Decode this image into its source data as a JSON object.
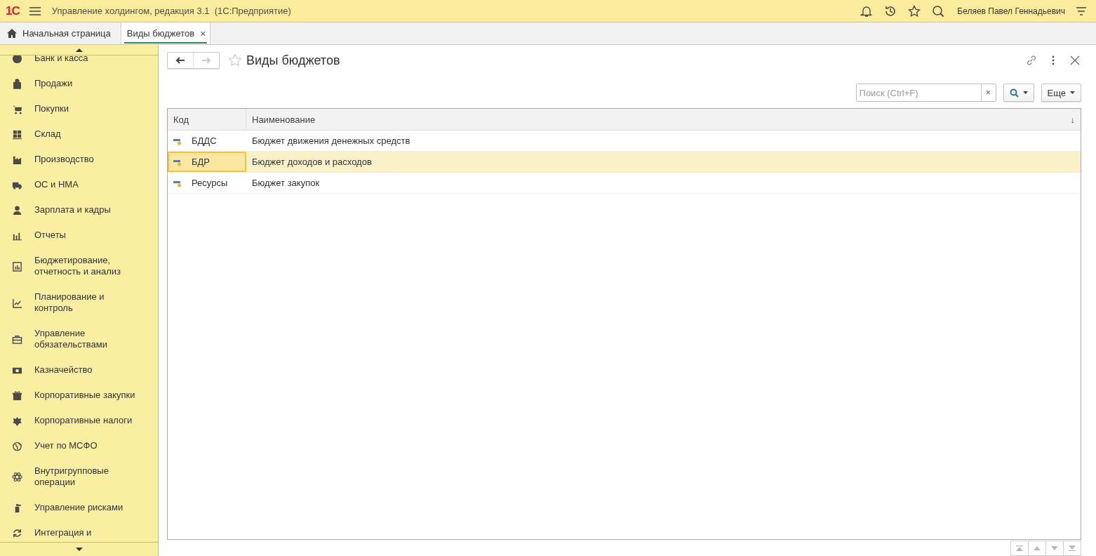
{
  "app": {
    "logo": "1С",
    "title": "Управление холдингом, редакция 3.1  (1С:Предприятие)",
    "user": "Беляев Павел Геннадьевич"
  },
  "tabs": [
    {
      "label": "Начальная страница",
      "selected": false,
      "kind": "home"
    },
    {
      "label": "Виды бюджетов",
      "selected": true,
      "kind": "page",
      "close": "×"
    }
  ],
  "sidebar": {
    "items": [
      {
        "label": "Банк и касса",
        "selected": false
      },
      {
        "label": "Продажи",
        "selected": false
      },
      {
        "label": "Покупки",
        "selected": false
      },
      {
        "label": "Склад",
        "selected": false
      },
      {
        "label": "Производство",
        "selected": false
      },
      {
        "label": "ОС и НМА",
        "selected": false
      },
      {
        "label": "Зарплата и кадры",
        "selected": false
      },
      {
        "label": "Отчеты",
        "selected": false
      },
      {
        "label": "Бюджетирование, отчетность и анализ",
        "selected": false
      },
      {
        "label": "Планирование и контроль",
        "selected": false
      },
      {
        "label": "Управление обязательствами",
        "selected": false
      },
      {
        "label": "Казначейство",
        "selected": false
      },
      {
        "label": "Корпоративные закупки",
        "selected": false
      },
      {
        "label": "Корпоративные налоги",
        "selected": false
      },
      {
        "label": "Учет по МСФО",
        "selected": false
      },
      {
        "label": "Внутригрупповые операции",
        "selected": false
      },
      {
        "label": "Управление рисками",
        "selected": false
      },
      {
        "label": "Интеграция и",
        "selected": false
      }
    ]
  },
  "form": {
    "title": "Виды бюджетов",
    "favorite": false,
    "search": {
      "placeholder": "Поиск (Ctrl+F)",
      "clear": "×"
    },
    "more_button": "Еще",
    "table": {
      "columns": [
        "Код",
        "Наименование"
      ],
      "sort_mark": "↓",
      "rows": [
        {
          "code": "БДДС",
          "name": "Бюджет движения денежных средств",
          "selected": false
        },
        {
          "code": "БДР",
          "name": "Бюджет доходов и расходов",
          "selected": true
        },
        {
          "code": "Ресурсы",
          "name": "Бюджет закупок",
          "selected": false
        }
      ]
    }
  }
}
